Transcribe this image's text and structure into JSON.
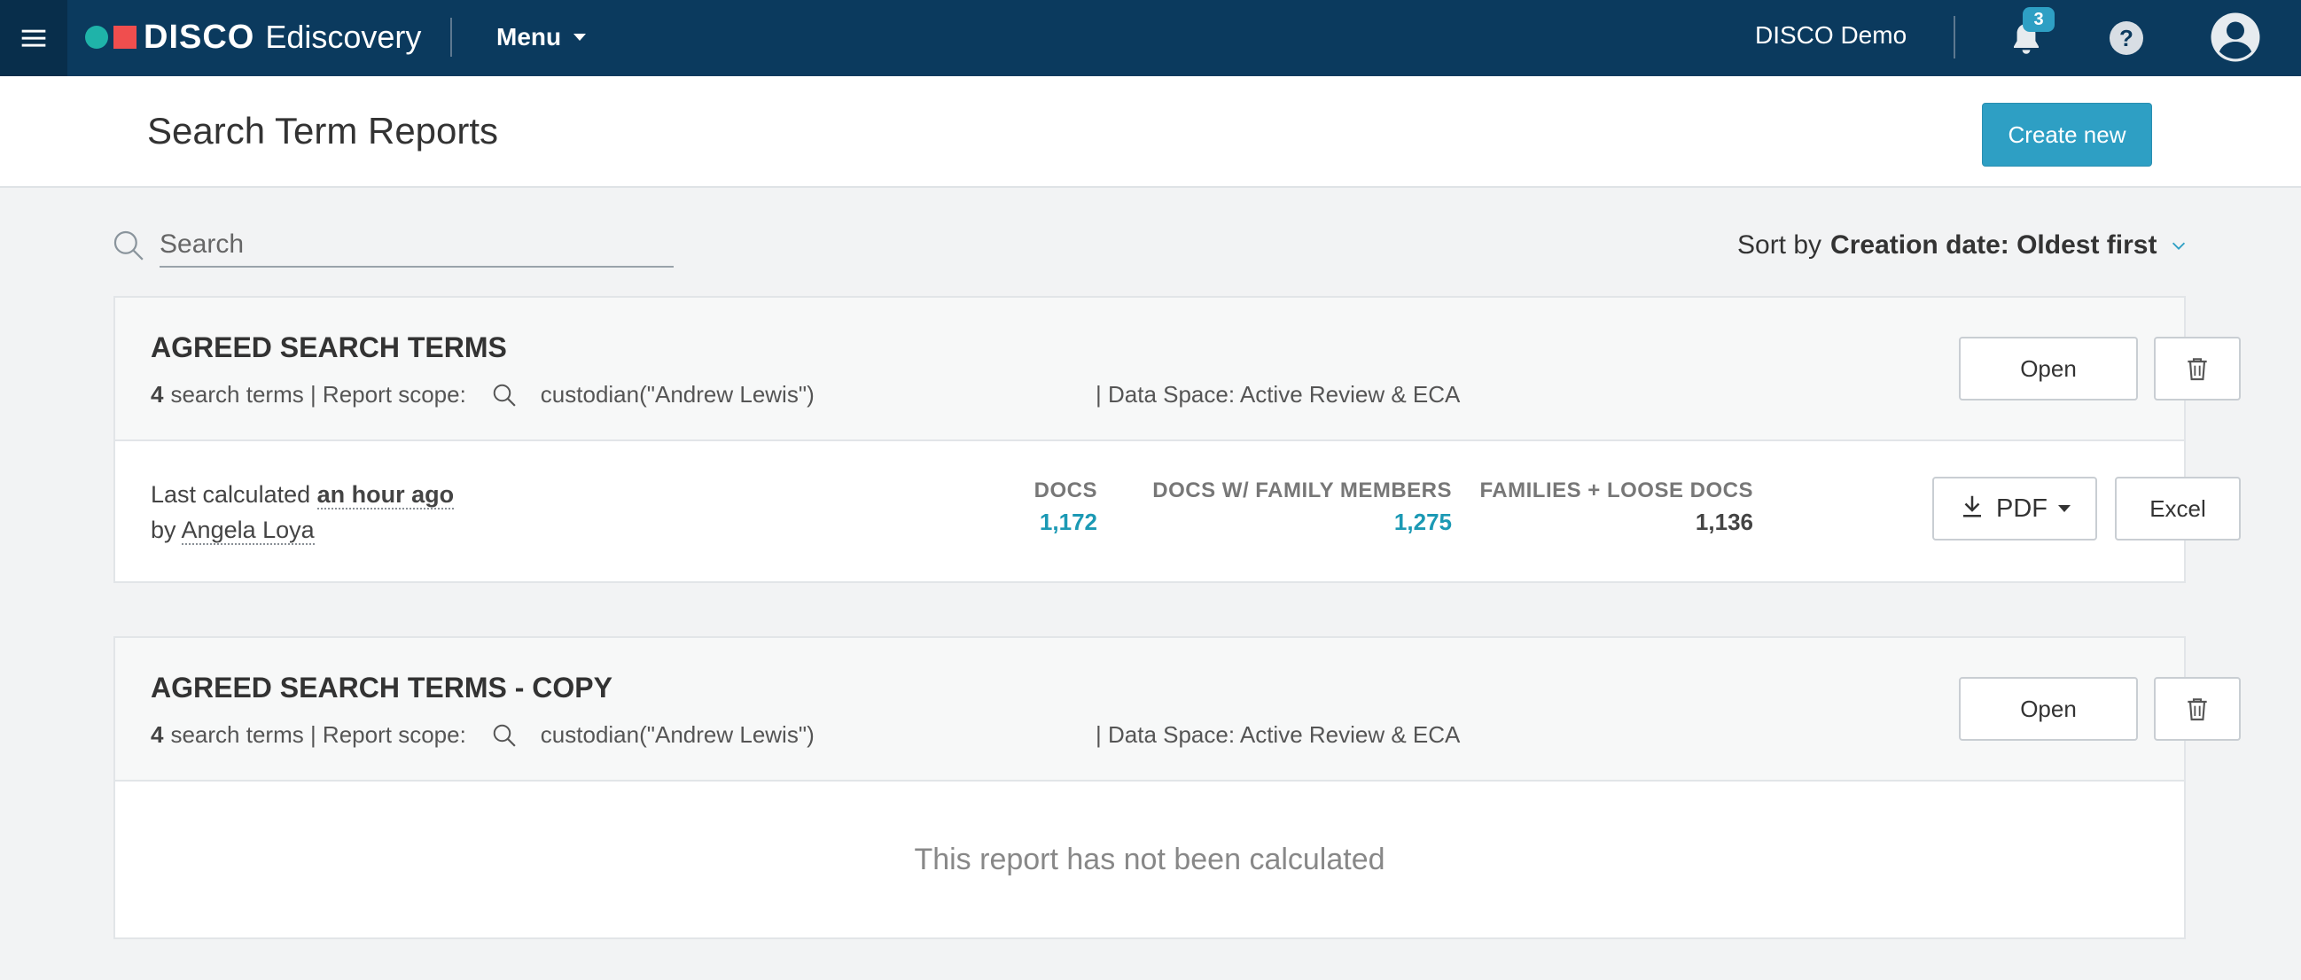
{
  "nav": {
    "brand": "DISCO",
    "product": "Ediscovery",
    "menu_label": "Menu",
    "user_name": "DISCO Demo",
    "notification_count": "3",
    "help_label": "?"
  },
  "header": {
    "title": "Search Term Reports",
    "create_label": "Create new"
  },
  "search": {
    "placeholder": "Search",
    "value": ""
  },
  "sort": {
    "prefix": "Sort by",
    "value": "Creation date: Oldest first"
  },
  "reports": [
    {
      "title": "AGREED SEARCH TERMS",
      "term_count": "4",
      "terms_label": "search terms | Report scope:",
      "scope": "custodian(\"Andrew Lewis\")",
      "data_space": "| Data Space: Active Review & ECA",
      "open_label": "Open",
      "calc_prefix": "Last calculated",
      "calc_time": "an hour ago",
      "by_prefix": "by",
      "calc_by": "Angela Loya",
      "stats": [
        {
          "label": "DOCS",
          "value": "1,172"
        },
        {
          "label": "DOCS W/ FAMILY MEMBERS",
          "value": "1,275"
        },
        {
          "label": "FAMILIES + LOOSE DOCS",
          "value": "1,136"
        }
      ],
      "pdf_label": "PDF",
      "excel_label": "Excel"
    },
    {
      "title": "AGREED SEARCH TERMS - COPY",
      "term_count": "4",
      "terms_label": "search terms | Report scope:",
      "scope": "custodian(\"Andrew Lewis\")",
      "data_space": "| Data Space: Active Review & ECA",
      "open_label": "Open",
      "status": "This report has not been calculated"
    }
  ],
  "colors": {
    "nav_bg": "#0b3a5e",
    "accent": "#2e9fc4",
    "link_value": "#1b99b4",
    "logo_teal": "#1fb3a9",
    "logo_red": "#f04e4e"
  }
}
